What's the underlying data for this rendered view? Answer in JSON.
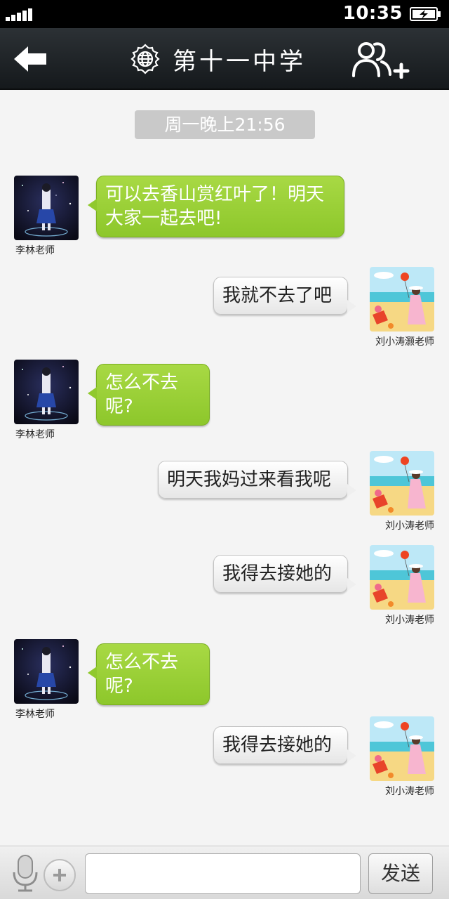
{
  "status_bar": {
    "time": "10:35",
    "signal_bars": 5
  },
  "header": {
    "title": "第十一中学",
    "back_icon": "back-arrow-icon",
    "group_icon": "globe-icon",
    "add_icon": "add-contacts-icon"
  },
  "chat": {
    "timestamp": "周一晚上21:56",
    "messages": [
      {
        "side": "left",
        "sender": "李林老师",
        "text": "可以去香山赏红叶了！明天大家一起去吧!",
        "avatar": "starry-girl-avatar"
      },
      {
        "side": "right",
        "sender": "刘小涛灏老师",
        "text": "我就不去了吧",
        "avatar": "beach-girl-avatar"
      },
      {
        "side": "left",
        "sender": "李林老师",
        "text": "怎么不去呢?",
        "avatar": "starry-girl-avatar"
      },
      {
        "side": "right",
        "sender": "刘小涛老师",
        "text": "明天我妈过来看我呢",
        "avatar": "beach-girl-avatar"
      },
      {
        "side": "right",
        "sender": "刘小涛老师",
        "text": "我得去接她的",
        "avatar": "beach-girl-avatar"
      },
      {
        "side": "left",
        "sender": "李林老师",
        "text": "怎么不去呢?",
        "avatar": "starry-girl-avatar"
      },
      {
        "side": "right",
        "sender": "刘小涛老师",
        "text": "我得去接她的",
        "avatar": "beach-girl-avatar"
      }
    ]
  },
  "input_bar": {
    "value": "",
    "send_label": "发送"
  },
  "colors": {
    "green_bubble": "#9dd23a",
    "header": "#1f2427",
    "background": "#f4f4f4"
  }
}
